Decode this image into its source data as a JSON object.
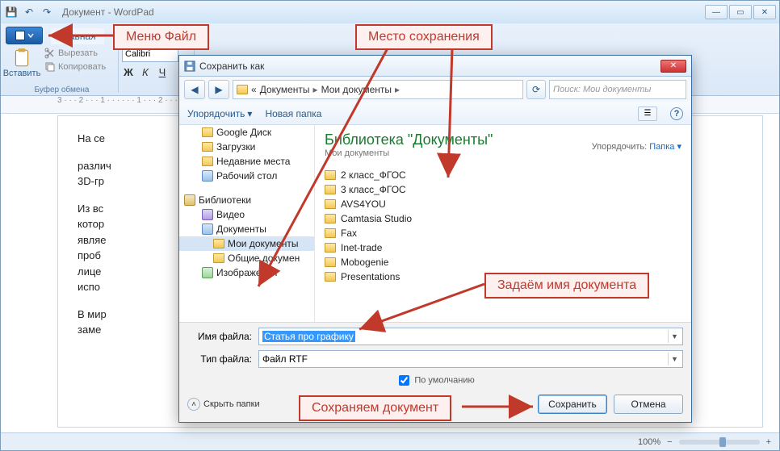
{
  "wordpad": {
    "title": "Документ - WordPad",
    "tab_home": "Главная",
    "clipboard": {
      "paste": "Вставить",
      "cut": "Вырезать",
      "copy": "Копировать",
      "group": "Буфер обмена"
    },
    "font": {
      "name": "Calibri",
      "bold": "Ж",
      "italic": "К",
      "underline": "Ч"
    },
    "ruler": "3 · · · 2 · · · 1 · · · · · · 1 · · · 2 · · · 3 · · · 4 · · · 5 · · · 6 · · · 7 · · · 8 · · · 9 · · · 10",
    "doc": {
      "p1": "На се",
      "p2": "различ",
      "p3": "3D-гр",
      "p4": "Из вс",
      "p5": "котор",
      "p6": "являе",
      "p7": "проб",
      "p8": "лице",
      "p9": "испо",
      "p10": "В мир",
      "p11": "заме"
    },
    "status": {
      "zoom": "100%",
      "minus": "−",
      "plus": "+"
    }
  },
  "dialog": {
    "title": "Сохранить как",
    "crumbs": {
      "prefix": "«",
      "seg1": "Документы",
      "seg2": "Мои документы",
      "sep": "▸"
    },
    "search_placeholder": "Поиск: Мои документы",
    "toolbar": {
      "organize": "Упорядочить",
      "new_folder": "Новая папка"
    },
    "library": {
      "title": "Библиотека \"Документы\"",
      "subtitle": "Мои документы",
      "sort_label": "Упорядочить:",
      "sort_value": "Папка ▾"
    },
    "tree": {
      "quick": [
        "Google Диск",
        "Загрузки",
        "Недавние места",
        "Рабочий стол"
      ],
      "libs_label": "Библиотеки",
      "libs": [
        "Видео",
        "Документы",
        "Мои документы",
        "Общие докумен",
        "Изображения"
      ]
    },
    "folders": [
      "2 класс_ФГОС",
      "3 класс_ФГОС",
      "AVS4YOU",
      "Camtasia Studio",
      "Fax",
      "Inet-trade",
      "Mobogenie",
      "Presentations"
    ],
    "filename_label": "Имя файла:",
    "filename_value": "Статья про графику",
    "filetype_label": "Тип файла:",
    "filetype_value": "Файл RTF",
    "default_cb": "По умолчанию",
    "hide_folders": "Скрыть папки",
    "save": "Сохранить",
    "cancel": "Отмена"
  },
  "callouts": {
    "file_menu": "Меню Файл",
    "save_location": "Место сохранения",
    "doc_name": "Задаём имя документа",
    "save_doc": "Сохраняем документ"
  }
}
